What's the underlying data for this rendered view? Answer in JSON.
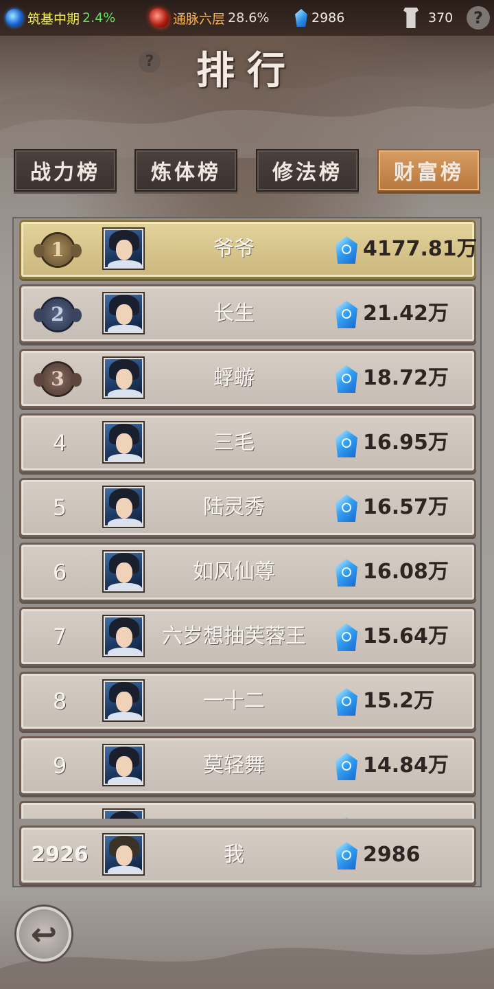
{
  "status_bar": {
    "cultivation": {
      "label": "筑基中期",
      "percent": "2.4%"
    },
    "meridian": {
      "label": "通脉六层",
      "percent": "28.6%"
    },
    "spirit_stones": "2986",
    "scroll_count": "370",
    "help": "?"
  },
  "header": {
    "title": "排行",
    "help": "?"
  },
  "tabs": [
    {
      "label": "战力榜",
      "active": false
    },
    {
      "label": "炼体榜",
      "active": false
    },
    {
      "label": "修法榜",
      "active": false
    },
    {
      "label": "财富榜",
      "active": true
    }
  ],
  "leaderboard": [
    {
      "rank": "1",
      "name": "爷爷",
      "value": "4177.81万"
    },
    {
      "rank": "2",
      "name": "长生",
      "value": "21.42万"
    },
    {
      "rank": "3",
      "name": "蜉蝣",
      "value": "18.72万"
    },
    {
      "rank": "4",
      "name": "三毛",
      "value": "16.95万"
    },
    {
      "rank": "5",
      "name": "陆灵秀",
      "value": "16.57万"
    },
    {
      "rank": "6",
      "name": "如风仙尊",
      "value": "16.08万"
    },
    {
      "rank": "7",
      "name": "六岁想抽芙蓉王",
      "value": "15.64万"
    },
    {
      "rank": "8",
      "name": "一十二",
      "value": "15.2万"
    },
    {
      "rank": "9",
      "name": "莫轻舞",
      "value": "14.84万"
    }
  ],
  "my_rank": {
    "rank": "2926",
    "name": "我",
    "value": "2986"
  },
  "icons": {
    "cultivation": "blue-orb-icon",
    "meridian": "red-flame-icon",
    "currency": "spirit-stone-icon",
    "scroll": "scroll-icon",
    "back": "return-arrow-icon"
  },
  "colors": {
    "active_tab": "#c8874b",
    "first_row": "#d9c98f",
    "row": "#cec5bd"
  }
}
